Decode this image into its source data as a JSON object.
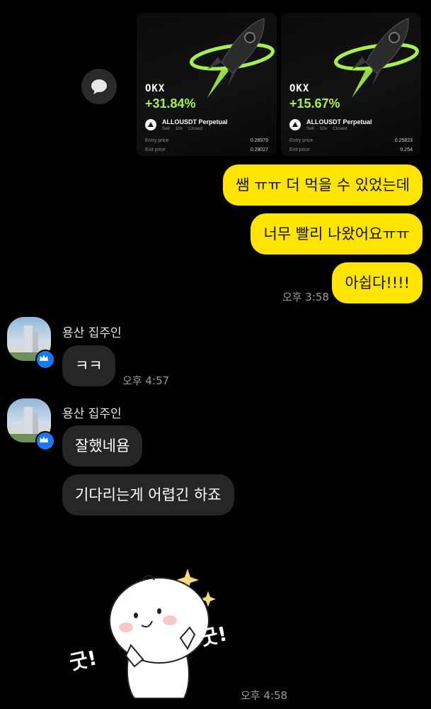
{
  "cards": [
    {
      "brand": "OKX",
      "pnl": "+31.84%",
      "ticker": "ALLOUSDT Perpetual",
      "side": "Sell",
      "leverage": "10x",
      "status": "Closed",
      "entry_label": "Entry price",
      "entry_price": "0.28979",
      "exit_label": "Exit price",
      "exit_price": "0.28027"
    },
    {
      "brand": "OKX",
      "pnl": "+15.67%",
      "ticker": "ALLOUSDT Perpetual",
      "side": "Sell",
      "leverage": "10x",
      "status": "Closed",
      "entry_label": "Entry price",
      "entry_price": "0.25823",
      "exit_label": "Exit price",
      "exit_price": "0.254"
    }
  ],
  "my_messages": [
    {
      "text": "쌤 ㅠㅠ 더 먹을 수 있었는데"
    },
    {
      "text": "너무 빨리 나왔어요ㅠㅠ"
    },
    {
      "text": "아쉽다!!!!"
    }
  ],
  "my_time": "오후 3:58",
  "groups": [
    {
      "sender": "용산 집주인",
      "messages": [
        "ㅋㅋ"
      ],
      "time": "오후 4:57"
    },
    {
      "sender": "용산 집주인",
      "messages": [
        "잘했네욤",
        "기다리는게 어렵긴 하죠"
      ],
      "time": ""
    }
  ],
  "sticker": {
    "caption_left": "굿!",
    "caption_right": "굿!"
  },
  "sticker_time": "오후 4:58",
  "colors": {
    "my_bubble": "#fee500",
    "their_bubble": "#262626",
    "pnl_green": "#a6f04b",
    "badge_blue": "#1877f2"
  },
  "icons": {
    "share": "speech-bubble-icon",
    "badge": "crown-icon"
  }
}
